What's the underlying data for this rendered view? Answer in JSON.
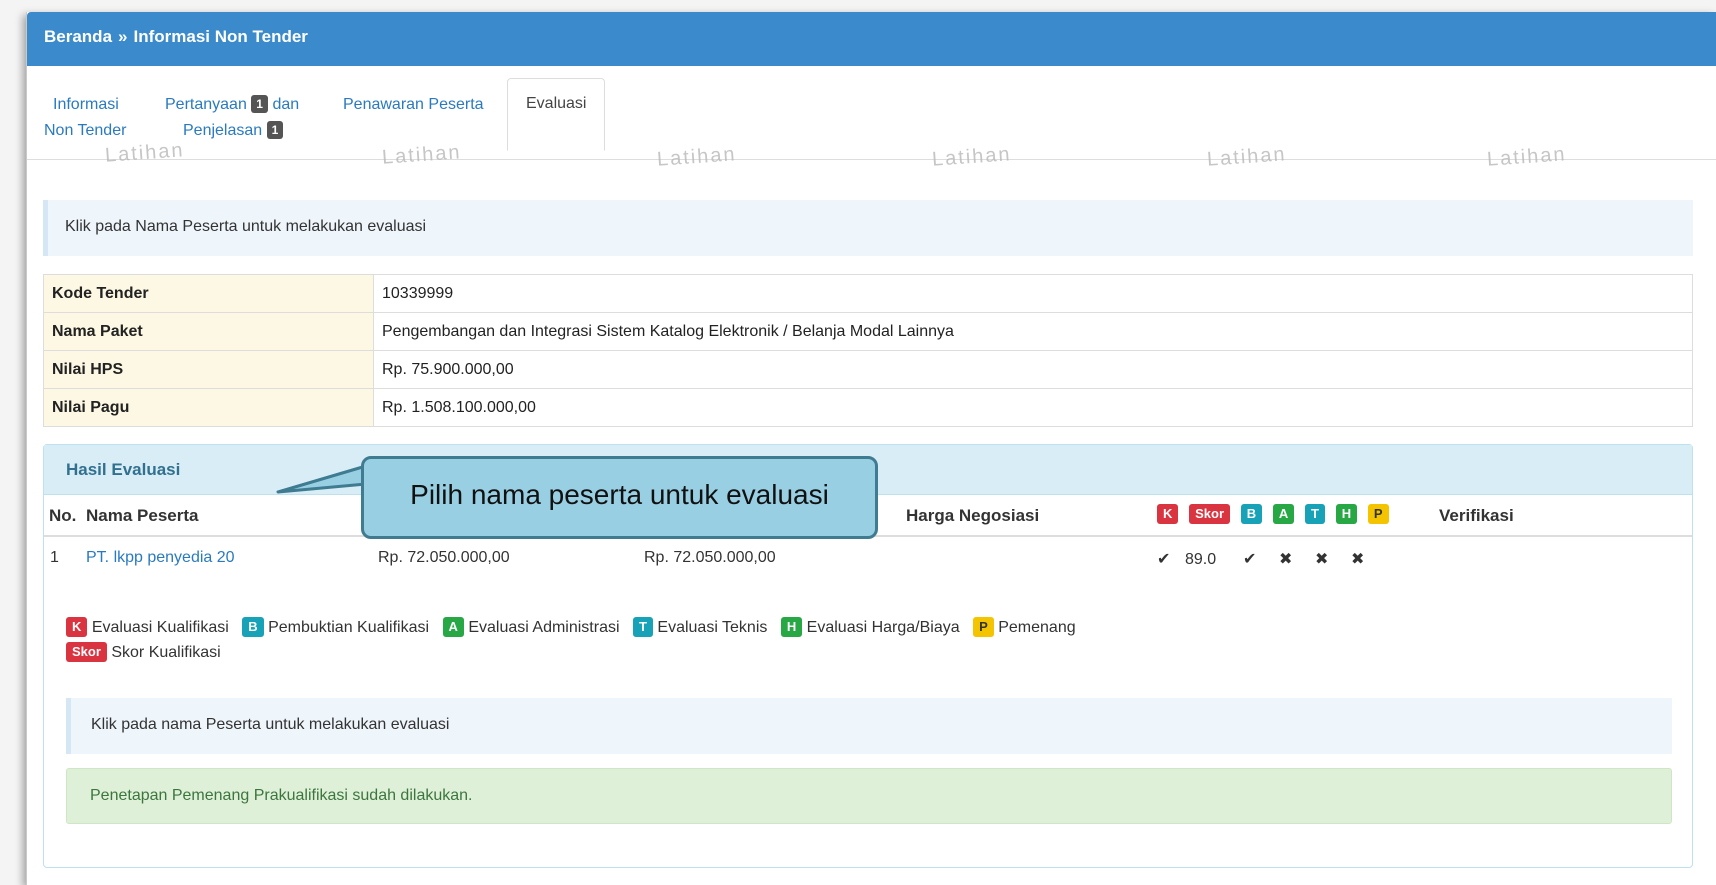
{
  "breadcrumb": {
    "home": "Beranda",
    "separator": "»",
    "current": "Informasi Non Tender"
  },
  "tabs": [
    {
      "line1": "Informasi",
      "line2": "Non Tender"
    },
    {
      "line1": "Pertanyaan",
      "badge1": "1",
      "line1b": "dan",
      "line2": "Penjelasan",
      "badge2": "1"
    },
    {
      "label": "Penawaran Peserta"
    },
    {
      "label": "Evaluasi",
      "active": true
    }
  ],
  "watermark": "Latihan",
  "info_message": "Klik pada Nama Peserta untuk melakukan evaluasi",
  "details": [
    {
      "key": "Kode Tender",
      "value": "10339999"
    },
    {
      "key": "Nama Paket",
      "value": "Pengembangan dan Integrasi Sistem Katalog Elektronik / Belanja Modal Lainnya"
    },
    {
      "key": "Nilai HPS",
      "value": "Rp. 75.900.000,00"
    },
    {
      "key": "Nilai Pagu",
      "value": "Rp. 1.508.100.000,00"
    }
  ],
  "result": {
    "title": "Hasil Evaluasi",
    "columns": {
      "no": "No.",
      "name": "Nama Peserta",
      "harga_negosiasi": "Harga Negosiasi",
      "verifikasi": "Verifikasi"
    },
    "badges": {
      "k": "K",
      "skor": "Skor",
      "b": "B",
      "a": "A",
      "t": "T",
      "h": "H",
      "p": "P"
    },
    "rows": [
      {
        "no": "1",
        "name": "PT. lkpp penyedia 20",
        "harga_penawaran": "Rp. 72.050.000,00",
        "harga_terkoreksi": "Rp. 72.050.000,00",
        "k": "✔",
        "skor": "89.0",
        "b": "✔",
        "a": "✖",
        "t": "✖",
        "h": "✖"
      }
    ],
    "legend": {
      "k": "Evaluasi Kualifikasi",
      "b": "Pembuktian Kualifikasi",
      "a": "Evaluasi Administrasi",
      "t": "Evaluasi Teknis",
      "h": "Evaluasi Harga/Biaya",
      "p": "Pemenang",
      "skor": "Skor Kualifikasi"
    },
    "inner_info": "Klik pada nama Peserta untuk melakukan evaluasi",
    "success_message": "Penetapan Pemenang Prakualifikasi sudah dilakukan."
  },
  "callout": "Pilih nama peserta untuk evaluasi",
  "colors": {
    "header": "#3b8acb",
    "link": "#2a7abf",
    "red": "#d9343f",
    "cyan": "#17a2b8",
    "green": "#28a745",
    "yellow": "#f5c400"
  }
}
